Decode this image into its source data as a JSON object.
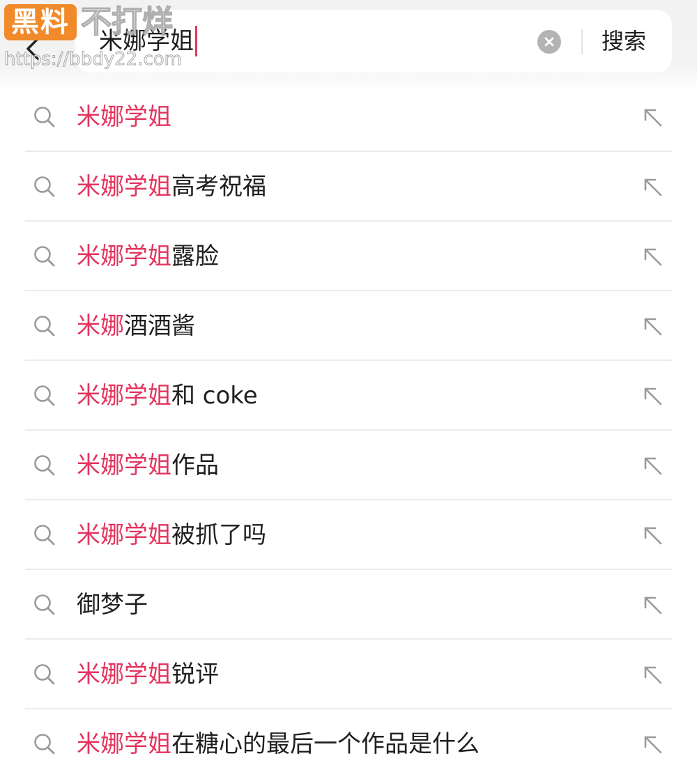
{
  "watermark": {
    "badge": "黑料",
    "title": "不打烊",
    "url": "https://bbdy22.com"
  },
  "search": {
    "query": "米娜学姐",
    "submit_label": "搜索"
  },
  "suggestions": [
    {
      "highlight": "米娜学姐",
      "rest": ""
    },
    {
      "highlight": "米娜学姐",
      "rest": "高考祝福"
    },
    {
      "highlight": "米娜学姐",
      "rest": "露脸"
    },
    {
      "highlight": "米娜",
      "rest": "酒酒酱"
    },
    {
      "highlight": "米娜学姐",
      "rest": "和 coke"
    },
    {
      "highlight": "米娜学姐",
      "rest": "作品"
    },
    {
      "highlight": "米娜学姐",
      "rest": "被抓了吗"
    },
    {
      "highlight": "",
      "rest": "御梦子"
    },
    {
      "highlight": "米娜学姐",
      "rest": "锐评"
    },
    {
      "highlight": "米娜学姐",
      "rest": "在糖心的最后一个作品是什么"
    }
  ],
  "colors": {
    "highlight": "#e3345e",
    "caret": "#e8355f",
    "watermark_badge": "#f08a2a"
  },
  "icons": {
    "back": "chevron-left-icon",
    "clear": "clear-circle-icon",
    "row_leading": "search-icon",
    "row_trailing": "fill-query-arrow-icon"
  }
}
